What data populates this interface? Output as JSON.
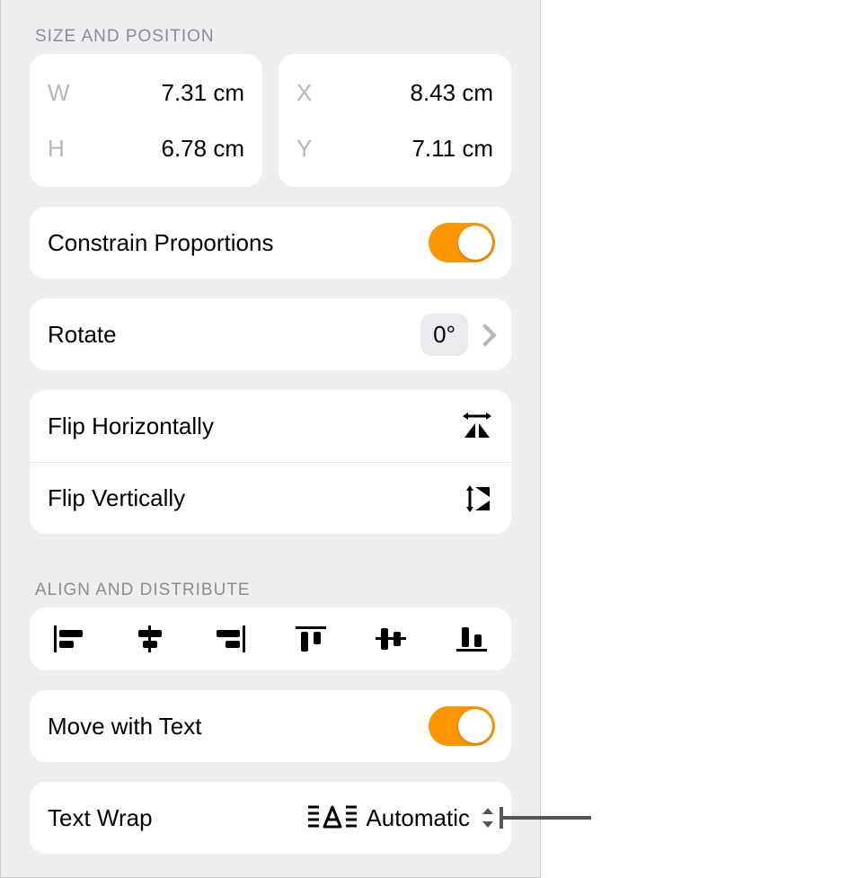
{
  "section1_title": "SIZE AND POSITION",
  "size": {
    "w_label": "W",
    "w_value": "7.31 cm",
    "h_label": "H",
    "h_value": "6.78 cm"
  },
  "position": {
    "x_label": "X",
    "x_value": "8.43 cm",
    "y_label": "Y",
    "y_value": "7.11 cm"
  },
  "constrain_label": "Constrain Proportions",
  "constrain_on": true,
  "rotate_label": "Rotate",
  "rotate_value": "0°",
  "flip_h_label": "Flip Horizontally",
  "flip_v_label": "Flip Vertically",
  "section2_title": "ALIGN AND DISTRIBUTE",
  "align_buttons": [
    "align-left",
    "align-center-h",
    "align-right",
    "align-top",
    "align-center-v",
    "align-bottom"
  ],
  "move_text_label": "Move with Text",
  "move_text_on": true,
  "wrap_label": "Text Wrap",
  "wrap_value": "Automatic",
  "colors": {
    "accent": "#ff9500"
  }
}
